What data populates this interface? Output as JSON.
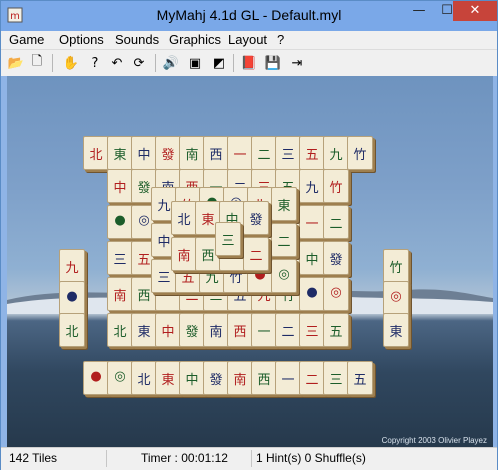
{
  "window": {
    "title": "MyMahj 4.1d GL - Default.myl"
  },
  "menu": [
    "Game",
    "Options",
    "Sounds",
    "Graphics",
    "Layout",
    "?"
  ],
  "toolbar": [
    {
      "name": "open-icon",
      "glyph": "📂"
    },
    {
      "name": "new-icon",
      "glyph": "🗋"
    },
    {
      "name": "hand-icon",
      "glyph": "✋"
    },
    {
      "name": "hint-icon",
      "glyph": "?"
    },
    {
      "name": "undo-icon",
      "glyph": "↶"
    },
    {
      "name": "shuffle-icon",
      "glyph": "⟳"
    },
    {
      "name": "sound-icon",
      "glyph": "🔊"
    },
    {
      "name": "tile-settings-icon",
      "glyph": "▣"
    },
    {
      "name": "board-settings-icon",
      "glyph": "◩"
    },
    {
      "name": "help-book-icon",
      "glyph": "📕"
    },
    {
      "name": "save-icon",
      "glyph": "💾"
    },
    {
      "name": "exit-icon",
      "glyph": "⇥"
    }
  ],
  "board": {
    "copyright": "Copyright 2003 Olivier Playez"
  },
  "status": {
    "tiles": "142 Tiles",
    "timer": "Timer : 00:01:12",
    "hints": "1 Hint(s) 0 Shuffle(s)"
  },
  "tiles_layout": [
    "北",
    "東",
    "中",
    "發",
    "南",
    "西",
    "一",
    "二",
    "三",
    "五",
    "九",
    "竹",
    "●",
    "◎"
  ]
}
